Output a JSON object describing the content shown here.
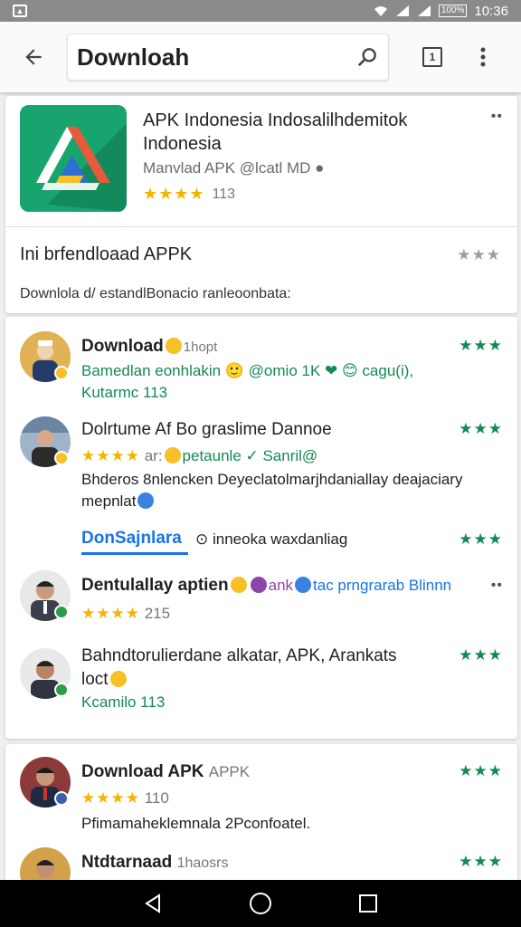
{
  "status_bar": {
    "battery": "100%",
    "time": "10:36"
  },
  "toolbar": {
    "search_value": "Downloah"
  },
  "app_card": {
    "title": "APK Indonesia Indosalilhdemitok Indonesia",
    "subtitle": "Manvlad APK @lcatl MD ●",
    "rating_count": "113",
    "download_label": "Ini brfendloaad APPK",
    "description": "Downlola d/ estandlBonacio ranleoonbata:"
  },
  "reviews": [
    {
      "name": "Download",
      "time": "1hopt",
      "line1": "Bamedlan eonhlakin 🙂 @omio 1K ❤ 😊 cagu(i),",
      "line2": "Kutarmc 113"
    },
    {
      "name": "Dolrtume Af Bo graslime Dannoe",
      "line1_rate": "ar:",
      "line1_rest": "petaunle ✓ Sanril@",
      "line2": "Bhderos 8nlencken Deyeclatolmarjhdaniallay deajaciary",
      "line3": "mepnlat"
    },
    {
      "tab_label": "DonSajnlara",
      "tab_rest": "inneoka waxdanliag"
    },
    {
      "name": "Dentulallay aptien",
      "name_rest_1": "ank",
      "name_rest_2": "tac prngrarab Blinnn",
      "count": "215"
    },
    {
      "name": "Bahndtorulierdane alkatar, APK, Arankats",
      "line2": "loct",
      "line3": "Kcamilo 113"
    }
  ],
  "reviews_b": [
    {
      "name": "Download APK",
      "name_tag": "APPK",
      "count": "110",
      "line": "Pfimamaheklemnala 2Pconfoatel."
    },
    {
      "name": "Ntdtarnaad",
      "time": "1haosrs"
    }
  ]
}
